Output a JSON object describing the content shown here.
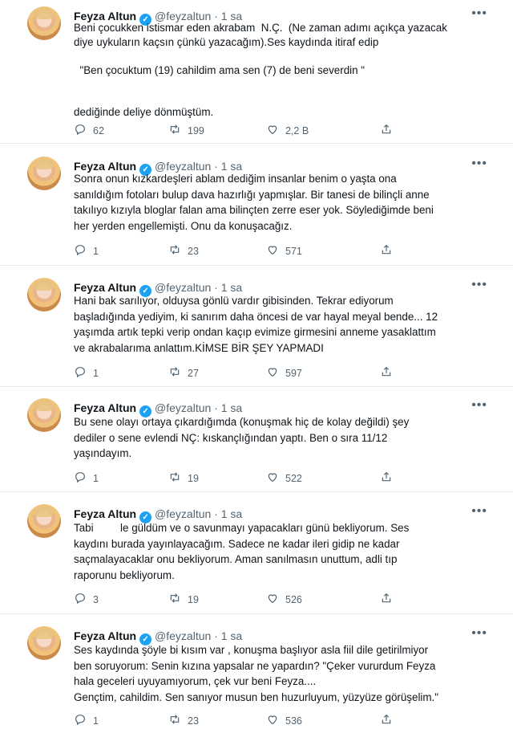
{
  "tweets": [
    {
      "name": "Feyza Altun",
      "handle": "@feyzaltun",
      "time": "1 sa",
      "lines": [
        "Beni çocukken istismar eden akrabam  N.Ç.  (Ne zaman adımı açıkça yazacak",
        "diye uykuların kaçsın çünkü yazacağım).Ses kaydında itiraf edip",
        "",
        "  \"Ben çocuktum (19) cahildim ama sen (7) de beni severdin \"",
        "",
        "",
        "dediğinde deliye dönmüştüm."
      ],
      "replies": "62",
      "retweets": "199",
      "likes": "2,2 B"
    },
    {
      "name": "Feyza Altun",
      "handle": "@feyzaltun",
      "time": "1 sa",
      "lines": [
        "Sonra onun kızkardeşleri ablam dediğim insanlar benim o yaşta ona",
        "sanıldığım fotoları bulup dava hazırlığı yapmışlar. Bir tanesi de bilinçli anne",
        "takılıyo kızıyla bloglar falan ama bilinçten zerre eser yok. Söylediğimde beni",
        "her yerden engellemişti. Onu da konuşacağız."
      ],
      "replies": "1",
      "retweets": "23",
      "likes": "571"
    },
    {
      "name": "Feyza Altun",
      "handle": "@feyzaltun",
      "time": "1 sa",
      "lines": [
        "Hani bak sarılıyor, olduysa gönlü vardır gibisinden. Tekrar ediyorum",
        "başladığında yediyim, ki sanırım daha öncesi de var hayal meyal bende... 12",
        "yaşımda artık tepki verip ondan kaçıp evimize girmesini anneme yasaklattım",
        "ve akrabalarıma anlattım.KİMSE BİR ŞEY YAPMADI"
      ],
      "replies": "1",
      "retweets": "27",
      "likes": "597"
    },
    {
      "name": "Feyza Altun",
      "handle": "@feyzaltun",
      "time": "1 sa",
      "lines": [
        "Bu sene olayı ortaya çıkardığımda (konuşmak hiç de kolay değildi) şey",
        "dediler o sene evlendi NÇ: kıskançlığından yaptı. Ben o sıra 11/12",
        "yaşındayım."
      ],
      "replies": "1",
      "retweets": "19",
      "likes": "522"
    },
    {
      "name": "Feyza Altun",
      "handle": "@feyzaltun",
      "time": "1 sa",
      "lines": [
        "Tabi         le güldüm ve o savunmayı yapacakları günü bekliyorum. Ses",
        "kaydını burada yayınlayacağım. Sadece ne kadar ileri gidip ne kadar",
        "saçmalayacaklar onu bekliyorum. Aman sanılmasın unuttum, adli tıp",
        "raporunu bekliyorum."
      ],
      "replies": "3",
      "retweets": "19",
      "likes": "526"
    },
    {
      "name": "Feyza Altun",
      "handle": "@feyzaltun",
      "time": "1 sa",
      "lines": [
        "Ses kaydında şöyle bi kısım var , konuşma başlıyor asla fiil dile getirilmiyor",
        "ben soruyorum: Senin kızına yapsalar ne yapardın? \"Çeker vururdum Feyza",
        "hala geceleri uyuyamıyorum, çek vur beni Feyza....",
        "Gençtim, cahildim. Sen sanıyor musun ben huzurluyum, yüzyüze görüşelim.\""
      ],
      "replies": "1",
      "retweets": "23",
      "likes": "536"
    }
  ]
}
